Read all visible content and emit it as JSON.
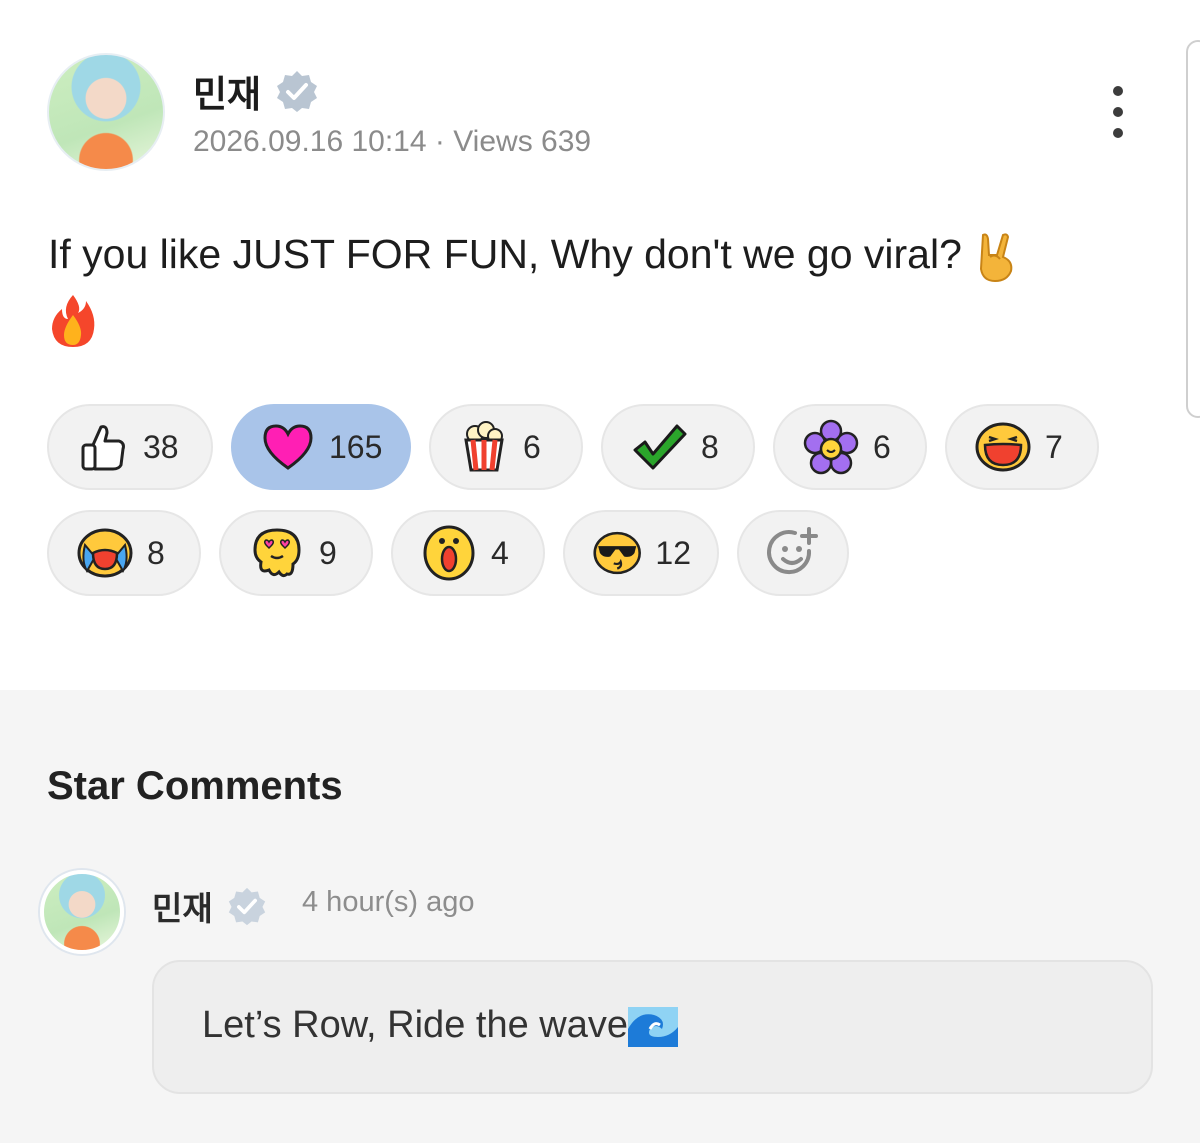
{
  "post": {
    "author_name": "민재",
    "meta": "2026.09.16 10:14 · Views 639",
    "text_line1": "If you like JUST FOR FUN, Why don't we go viral?",
    "text_emoji1": "rock-hand",
    "text_emoji2": "fire",
    "more_icon": "more-vertical-icon"
  },
  "reactions": [
    {
      "icon": "thumbs-up",
      "count": "38",
      "active": false
    },
    {
      "icon": "heart",
      "count": "165",
      "active": true
    },
    {
      "icon": "popcorn",
      "count": "6",
      "active": false
    },
    {
      "icon": "check",
      "count": "8",
      "active": false
    },
    {
      "icon": "flower",
      "count": "6",
      "active": false
    },
    {
      "icon": "laughing-face",
      "count": "7",
      "active": false
    },
    {
      "icon": "crying-face",
      "count": "8",
      "active": false
    },
    {
      "icon": "heart-eyes-melting",
      "count": "9",
      "active": false
    },
    {
      "icon": "surprised-face",
      "count": "4",
      "active": false
    },
    {
      "icon": "sunglasses-face",
      "count": "12",
      "active": false
    }
  ],
  "add_reaction_icon": "add-reaction-icon",
  "comments": {
    "title": "Star Comments",
    "items": [
      {
        "author": "민재",
        "time": "4 hour(s) ago",
        "text": "Let’s Row, Ride the wave",
        "emoji": "water-wave"
      }
    ]
  },
  "colors": {
    "active_chip": "#a9c4e9",
    "chip": "#f2f2f2",
    "comments_bg": "#f5f5f5",
    "verified": "#b9c5d2"
  }
}
